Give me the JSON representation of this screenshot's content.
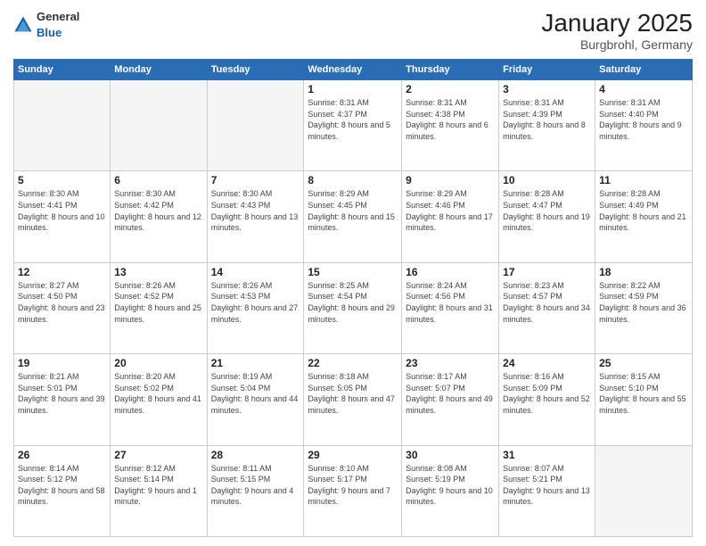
{
  "header": {
    "logo": {
      "general": "General",
      "blue": "Blue"
    },
    "title": "January 2025",
    "subtitle": "Burgbrohl, Germany"
  },
  "calendar": {
    "days_of_week": [
      "Sunday",
      "Monday",
      "Tuesday",
      "Wednesday",
      "Thursday",
      "Friday",
      "Saturday"
    ],
    "weeks": [
      [
        {
          "day": "",
          "info": ""
        },
        {
          "day": "",
          "info": ""
        },
        {
          "day": "",
          "info": ""
        },
        {
          "day": "1",
          "info": "Sunrise: 8:31 AM\nSunset: 4:37 PM\nDaylight: 8 hours\nand 5 minutes."
        },
        {
          "day": "2",
          "info": "Sunrise: 8:31 AM\nSunset: 4:38 PM\nDaylight: 8 hours\nand 6 minutes."
        },
        {
          "day": "3",
          "info": "Sunrise: 8:31 AM\nSunset: 4:39 PM\nDaylight: 8 hours\nand 8 minutes."
        },
        {
          "day": "4",
          "info": "Sunrise: 8:31 AM\nSunset: 4:40 PM\nDaylight: 8 hours\nand 9 minutes."
        }
      ],
      [
        {
          "day": "5",
          "info": "Sunrise: 8:30 AM\nSunset: 4:41 PM\nDaylight: 8 hours\nand 10 minutes."
        },
        {
          "day": "6",
          "info": "Sunrise: 8:30 AM\nSunset: 4:42 PM\nDaylight: 8 hours\nand 12 minutes."
        },
        {
          "day": "7",
          "info": "Sunrise: 8:30 AM\nSunset: 4:43 PM\nDaylight: 8 hours\nand 13 minutes."
        },
        {
          "day": "8",
          "info": "Sunrise: 8:29 AM\nSunset: 4:45 PM\nDaylight: 8 hours\nand 15 minutes."
        },
        {
          "day": "9",
          "info": "Sunrise: 8:29 AM\nSunset: 4:46 PM\nDaylight: 8 hours\nand 17 minutes."
        },
        {
          "day": "10",
          "info": "Sunrise: 8:28 AM\nSunset: 4:47 PM\nDaylight: 8 hours\nand 19 minutes."
        },
        {
          "day": "11",
          "info": "Sunrise: 8:28 AM\nSunset: 4:49 PM\nDaylight: 8 hours\nand 21 minutes."
        }
      ],
      [
        {
          "day": "12",
          "info": "Sunrise: 8:27 AM\nSunset: 4:50 PM\nDaylight: 8 hours\nand 23 minutes."
        },
        {
          "day": "13",
          "info": "Sunrise: 8:26 AM\nSunset: 4:52 PM\nDaylight: 8 hours\nand 25 minutes."
        },
        {
          "day": "14",
          "info": "Sunrise: 8:26 AM\nSunset: 4:53 PM\nDaylight: 8 hours\nand 27 minutes."
        },
        {
          "day": "15",
          "info": "Sunrise: 8:25 AM\nSunset: 4:54 PM\nDaylight: 8 hours\nand 29 minutes."
        },
        {
          "day": "16",
          "info": "Sunrise: 8:24 AM\nSunset: 4:56 PM\nDaylight: 8 hours\nand 31 minutes."
        },
        {
          "day": "17",
          "info": "Sunrise: 8:23 AM\nSunset: 4:57 PM\nDaylight: 8 hours\nand 34 minutes."
        },
        {
          "day": "18",
          "info": "Sunrise: 8:22 AM\nSunset: 4:59 PM\nDaylight: 8 hours\nand 36 minutes."
        }
      ],
      [
        {
          "day": "19",
          "info": "Sunrise: 8:21 AM\nSunset: 5:01 PM\nDaylight: 8 hours\nand 39 minutes."
        },
        {
          "day": "20",
          "info": "Sunrise: 8:20 AM\nSunset: 5:02 PM\nDaylight: 8 hours\nand 41 minutes."
        },
        {
          "day": "21",
          "info": "Sunrise: 8:19 AM\nSunset: 5:04 PM\nDaylight: 8 hours\nand 44 minutes."
        },
        {
          "day": "22",
          "info": "Sunrise: 8:18 AM\nSunset: 5:05 PM\nDaylight: 8 hours\nand 47 minutes."
        },
        {
          "day": "23",
          "info": "Sunrise: 8:17 AM\nSunset: 5:07 PM\nDaylight: 8 hours\nand 49 minutes."
        },
        {
          "day": "24",
          "info": "Sunrise: 8:16 AM\nSunset: 5:09 PM\nDaylight: 8 hours\nand 52 minutes."
        },
        {
          "day": "25",
          "info": "Sunrise: 8:15 AM\nSunset: 5:10 PM\nDaylight: 8 hours\nand 55 minutes."
        }
      ],
      [
        {
          "day": "26",
          "info": "Sunrise: 8:14 AM\nSunset: 5:12 PM\nDaylight: 8 hours\nand 58 minutes."
        },
        {
          "day": "27",
          "info": "Sunrise: 8:12 AM\nSunset: 5:14 PM\nDaylight: 9 hours\nand 1 minute."
        },
        {
          "day": "28",
          "info": "Sunrise: 8:11 AM\nSunset: 5:15 PM\nDaylight: 9 hours\nand 4 minutes."
        },
        {
          "day": "29",
          "info": "Sunrise: 8:10 AM\nSunset: 5:17 PM\nDaylight: 9 hours\nand 7 minutes."
        },
        {
          "day": "30",
          "info": "Sunrise: 8:08 AM\nSunset: 5:19 PM\nDaylight: 9 hours\nand 10 minutes."
        },
        {
          "day": "31",
          "info": "Sunrise: 8:07 AM\nSunset: 5:21 PM\nDaylight: 9 hours\nand 13 minutes."
        },
        {
          "day": "",
          "info": ""
        }
      ]
    ]
  }
}
